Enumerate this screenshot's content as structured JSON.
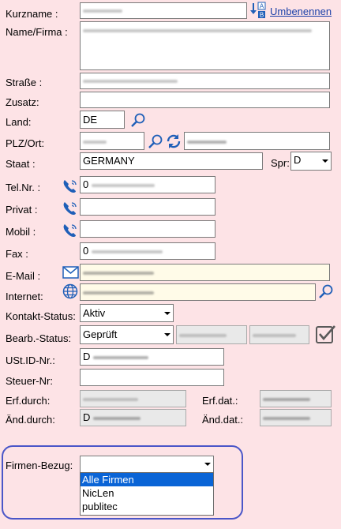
{
  "labels": {
    "kurzname": "Kurzname :",
    "name_firma": "Name/Firma :",
    "strasse": "Straße :",
    "zusatz": "Zusatz:",
    "land": "Land:",
    "plz_ort": "PLZ/Ort:",
    "staat": "Staat :",
    "spr": "Spr:",
    "telnr": "Tel.Nr. :",
    "privat": "Privat :",
    "mobil": "Mobil :",
    "fax": "Fax :",
    "email": "E-Mail :",
    "internet": "Internet:",
    "kontakt_status": "Kontakt-Status:",
    "bearb_status": "Bearb.-Status:",
    "ustid": "USt.ID-Nr.:",
    "steuer": "Steuer-Nr:",
    "erf_durch": "Erf.durch:",
    "erf_dat": "Erf.dat.:",
    "aend_durch": "Änd.durch:",
    "aend_dat": "Änd.dat.:",
    "firmen_bezug": "Firmen-Bezug:"
  },
  "actions": {
    "umbenennen": "Umbenennen"
  },
  "values": {
    "land": "DE",
    "staat": "GERMANY",
    "spr": "D",
    "tel_prefix": "0",
    "fax_prefix": "0",
    "ustid_prefix": "D",
    "aend_durch_prefix": "D",
    "kontakt_status": "Aktiv",
    "bearb_status": "Geprüft",
    "firmen_bezug": ""
  },
  "firmen_options": [
    "Alle Firmen",
    "NicLen",
    "publitec"
  ],
  "firmen_selected_index": 0,
  "colors": {
    "background": "#fde3e6",
    "accent": "#1f5fb8",
    "group_border": "#4a56c8",
    "selection": "#0a64d6"
  }
}
